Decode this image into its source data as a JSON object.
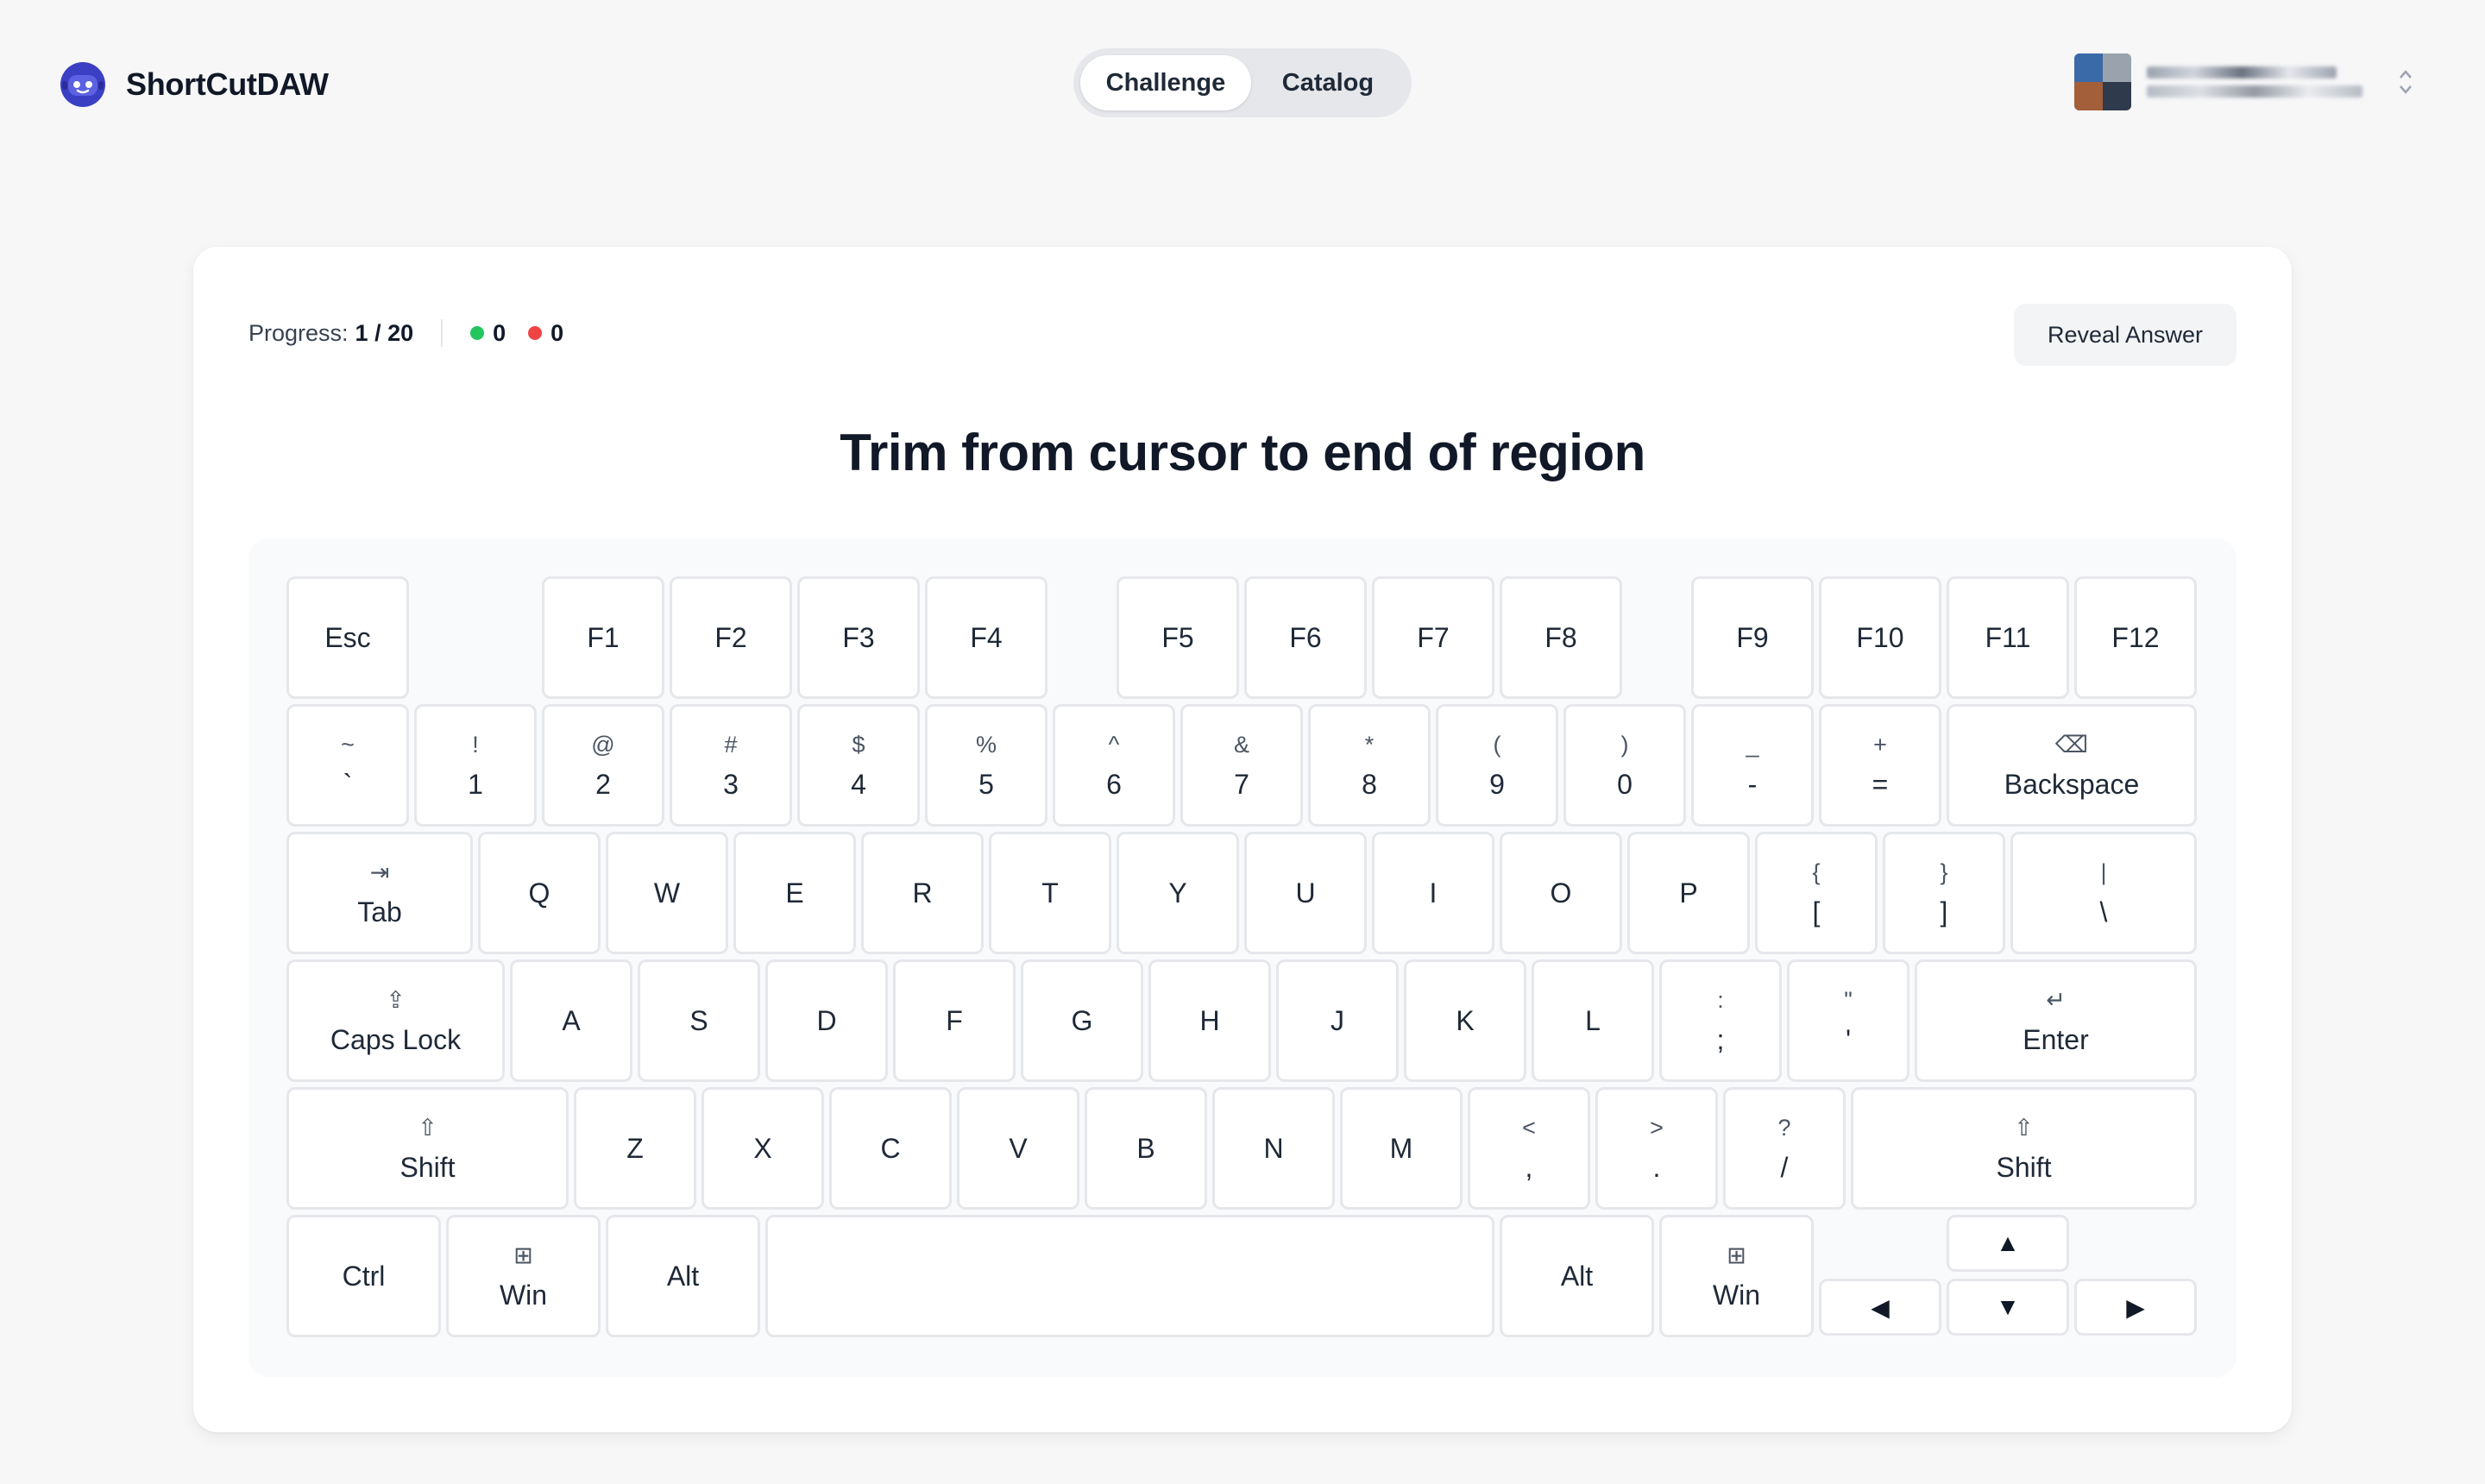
{
  "app": {
    "name": "ShortCutDAW"
  },
  "nav": {
    "tabs": [
      {
        "label": "Challenge",
        "active": true
      },
      {
        "label": "Catalog",
        "active": false
      }
    ]
  },
  "challenge": {
    "progress_label": "Progress:",
    "progress_value": "1 / 20",
    "correct_count": "0",
    "wrong_count": "0",
    "reveal_label": "Reveal Answer",
    "question": "Trim from cursor to end of region"
  },
  "colors": {
    "correct": "#22c55e",
    "wrong": "#ef4444",
    "accent": "#3b3fc4"
  },
  "keyboard": {
    "row_fn": [
      "Esc",
      "F1",
      "F2",
      "F3",
      "F4",
      "F5",
      "F6",
      "F7",
      "F8",
      "F9",
      "F10",
      "F11",
      "F12"
    ],
    "row_num": [
      {
        "top": "~",
        "bot": "`"
      },
      {
        "top": "!",
        "bot": "1"
      },
      {
        "top": "@",
        "bot": "2"
      },
      {
        "top": "#",
        "bot": "3"
      },
      {
        "top": "$",
        "bot": "4"
      },
      {
        "top": "%",
        "bot": "5"
      },
      {
        "top": "^",
        "bot": "6"
      },
      {
        "top": "&",
        "bot": "7"
      },
      {
        "top": "*",
        "bot": "8"
      },
      {
        "top": "(",
        "bot": "9"
      },
      {
        "top": ")",
        "bot": "0"
      },
      {
        "top": "_",
        "bot": "-"
      },
      {
        "top": "+",
        "bot": "="
      },
      {
        "top": "⌫",
        "bot": "Backspace"
      }
    ],
    "row_q": [
      {
        "top": "⇥",
        "bot": "Tab"
      },
      {
        "bot": "Q"
      },
      {
        "bot": "W"
      },
      {
        "bot": "E"
      },
      {
        "bot": "R"
      },
      {
        "bot": "T"
      },
      {
        "bot": "Y"
      },
      {
        "bot": "U"
      },
      {
        "bot": "I"
      },
      {
        "bot": "O"
      },
      {
        "bot": "P"
      },
      {
        "top": "{",
        "bot": "["
      },
      {
        "top": "}",
        "bot": "]"
      },
      {
        "top": "|",
        "bot": "\\"
      }
    ],
    "row_a": [
      {
        "top": "⇪",
        "bot": "Caps Lock"
      },
      {
        "bot": "A"
      },
      {
        "bot": "S"
      },
      {
        "bot": "D"
      },
      {
        "bot": "F"
      },
      {
        "bot": "G"
      },
      {
        "bot": "H"
      },
      {
        "bot": "J"
      },
      {
        "bot": "K"
      },
      {
        "bot": "L"
      },
      {
        "top": ":",
        "bot": ";"
      },
      {
        "top": "\"",
        "bot": "'"
      },
      {
        "top": "↵",
        "bot": "Enter"
      }
    ],
    "row_z": [
      {
        "top": "⇧",
        "bot": "Shift"
      },
      {
        "bot": "Z"
      },
      {
        "bot": "X"
      },
      {
        "bot": "C"
      },
      {
        "bot": "V"
      },
      {
        "bot": "B"
      },
      {
        "bot": "N"
      },
      {
        "bot": "M"
      },
      {
        "top": "<",
        "bot": ","
      },
      {
        "top": ">",
        "bot": "."
      },
      {
        "top": "?",
        "bot": "/"
      },
      {
        "top": "⇧",
        "bot": "Shift"
      }
    ],
    "row_bottom": [
      {
        "bot": "Ctrl"
      },
      {
        "top": "⊞",
        "bot": "Win"
      },
      {
        "bot": "Alt"
      },
      {
        "bot": ""
      },
      {
        "bot": "Alt"
      },
      {
        "top": "⊞",
        "bot": "Win"
      }
    ],
    "arrows": {
      "up": "▲",
      "left": "◀",
      "down": "▼",
      "right": "▶"
    }
  }
}
